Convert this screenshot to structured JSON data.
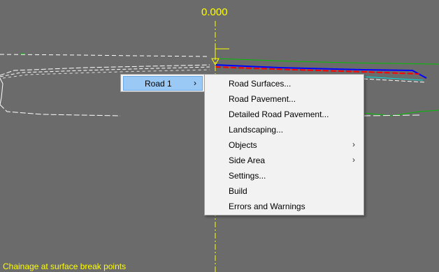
{
  "viewport": {
    "chainage_value": "0.000",
    "status_text": "Chainage at surface break points",
    "colors": {
      "background": "#6b6b6b",
      "chainage_line": "#ffff00",
      "road_edge": "#0000ff",
      "surface_red": "#ff0000",
      "ground_green": "#00c000",
      "cyan_line": "#00e0e0",
      "white_lines": "#ffffff"
    }
  },
  "context_menu": {
    "parent_item": {
      "label": "Road 1",
      "arrow": "›",
      "highlight": "#99c9f4"
    },
    "submenu": [
      {
        "label": "Road Surfaces...",
        "has_submenu": false
      },
      {
        "label": "Road Pavement...",
        "has_submenu": false
      },
      {
        "label": "Detailed Road Pavement...",
        "has_submenu": false
      },
      {
        "label": "Landscaping...",
        "has_submenu": false
      },
      {
        "label": "Objects",
        "has_submenu": true,
        "arrow": "›"
      },
      {
        "label": "Side Area",
        "has_submenu": true,
        "arrow": "›"
      },
      {
        "label": "Settings...",
        "has_submenu": false
      },
      {
        "label": "Build",
        "has_submenu": false
      },
      {
        "label": "Errors and Warnings",
        "has_submenu": false
      }
    ]
  }
}
